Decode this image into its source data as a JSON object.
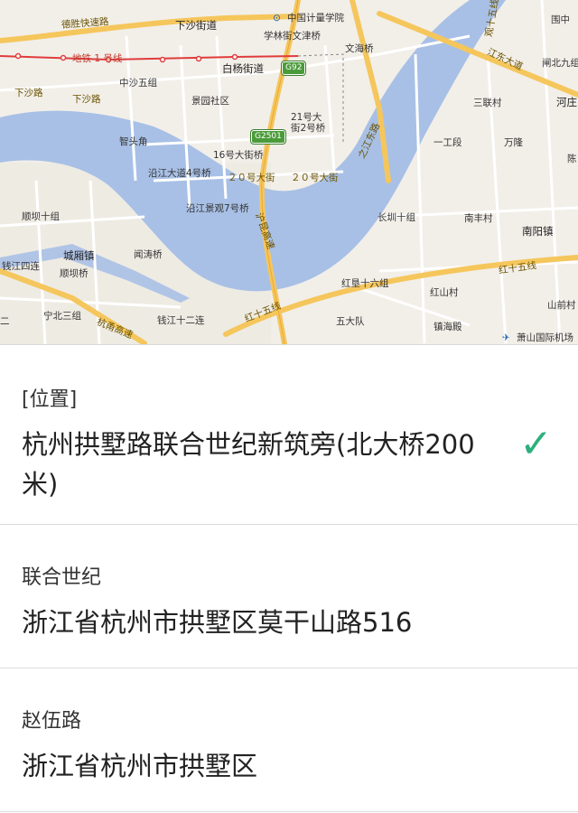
{
  "map": {
    "labels": {
      "deshengkuaisu": "德胜快速路",
      "xiashajiedao": "下沙街道",
      "zhongguojiliang": "中国计量学院",
      "xuelinjie": "学林街文津桥",
      "wenhaiqiao": "文海桥",
      "jiangdongdadao": "江东大道",
      "ditie": "地铁 1 号线",
      "baiyangjiedao": "白杨街道",
      "xiashalu_w": "下沙路",
      "xiashalu": "下沙路",
      "zhongshawuzu": "中沙五组",
      "jingyuansheqU": "景园社区",
      "hao21da": "21号大街2号桥",
      "zhijiangdonglu": "之江东路",
      "zhitoujiao": "智头角",
      "hao16": "16号大街桥",
      "yanjiang4": "沿江大道4号桥",
      "hao20a": "２０号大街",
      "hao20b": "２０号大街",
      "yanjiang7": "沿江景观7号桥",
      "hulugaosu": "沪昆高速",
      "shunbashi": "顺坝十组",
      "chengxiangzhen": "城厢镇",
      "wentaoqiao": "闻涛桥",
      "shunbaqiao": "顺坝桥",
      "qianjiang4": "钱江四连",
      "ningbei3": "宁北三组",
      "hangnangaosu": "杭甬高速",
      "qianjiang12": "钱江十二连",
      "hongshiwuxian": "红十五线",
      "hongshiwuxian2": "红十五线",
      "hongken16": "红垦十六组",
      "hongshancun": "红山村",
      "wudadui": "五大队",
      "zhenhaidian": "镇海殿",
      "changban10": "长圳十组",
      "nanfengcun": "南丰村",
      "nanyangzhen": "南阳镇",
      "yigongduan": "一工段",
      "wanlong": "万隆",
      "sanliancun": "三联村",
      "heliang": "河庄",
      "zhabeijiuzu": "闸北九组",
      "tuzhong": "围中",
      "xiaoshanjichang": "萧山国际机场",
      "shanqiancun": "山前村",
      "guan15": "观十五线",
      "chen": "陈",
      "ershi": "二"
    },
    "shields": {
      "g92": "G92",
      "g2501": "G2501"
    }
  },
  "list": [
    {
      "title": "[位置]",
      "subtitle": "杭州拱墅路联合世纪新筑旁(北大桥200米)",
      "selected": true
    },
    {
      "title": "联合世纪",
      "subtitle": "浙江省杭州市拱墅区莫干山路516",
      "selected": false
    },
    {
      "title": "赵伍路",
      "subtitle": "浙江省杭州市拱墅区",
      "selected": false
    }
  ],
  "icons": {
    "check": "checkmark-icon",
    "airport": "airport-icon",
    "poi": "school-icon"
  },
  "colors": {
    "river": "#a8c0e6",
    "road_major": "#f5c65c",
    "road_minor": "#ffffff",
    "check": "#2db07c",
    "metro": "#e03c3c"
  }
}
